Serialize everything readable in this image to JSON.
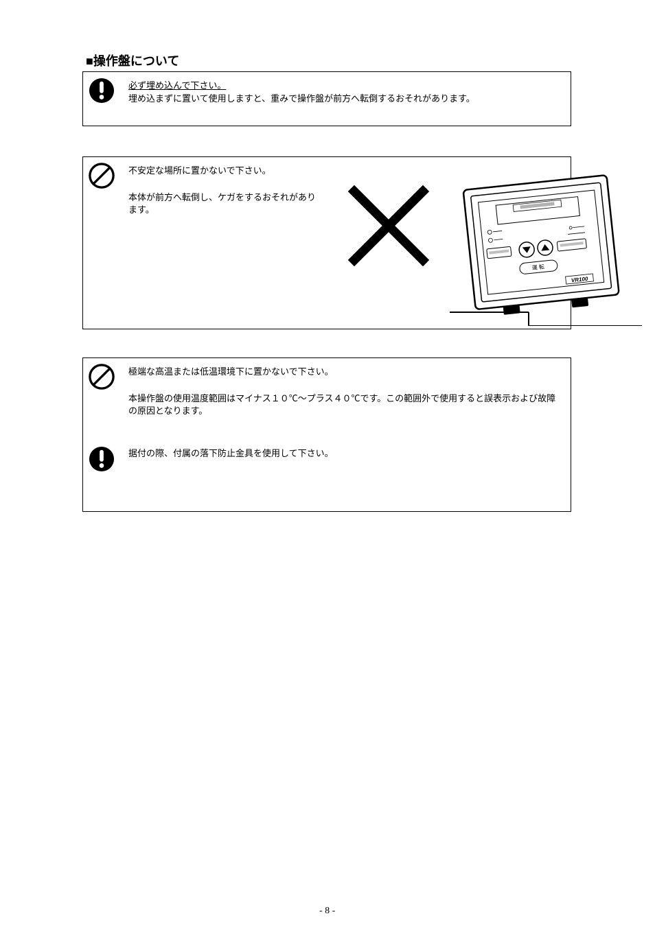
{
  "page": {
    "title": "■操作盤について",
    "number": "- 8 -"
  },
  "box1": {
    "line1_underlined": "必ず埋め込んで下さい。",
    "line2": "埋め込まずに置いて使用しますと、重みで操作盤が前方へ転倒するおそれがあります。"
  },
  "box2": {
    "line1": "不安定な場所に置かないで下さい。",
    "line2": "本体が前方へ転倒し、ケガをするおそれがあります。"
  },
  "box3": {
    "para1": "極端な高温または低温環境下に置かないで下さい。",
    "para2": "本操作盤の使用温度範囲はマイナス１０℃～プラス４０℃です。この範囲外で使用すると誤表示および故障の原因となります。",
    "para3": "据付の際、付属の落下防止金具を使用して下さい。"
  },
  "icons": {
    "exclaim": "exclaim-icon",
    "prohibit": "prohibit-icon"
  }
}
